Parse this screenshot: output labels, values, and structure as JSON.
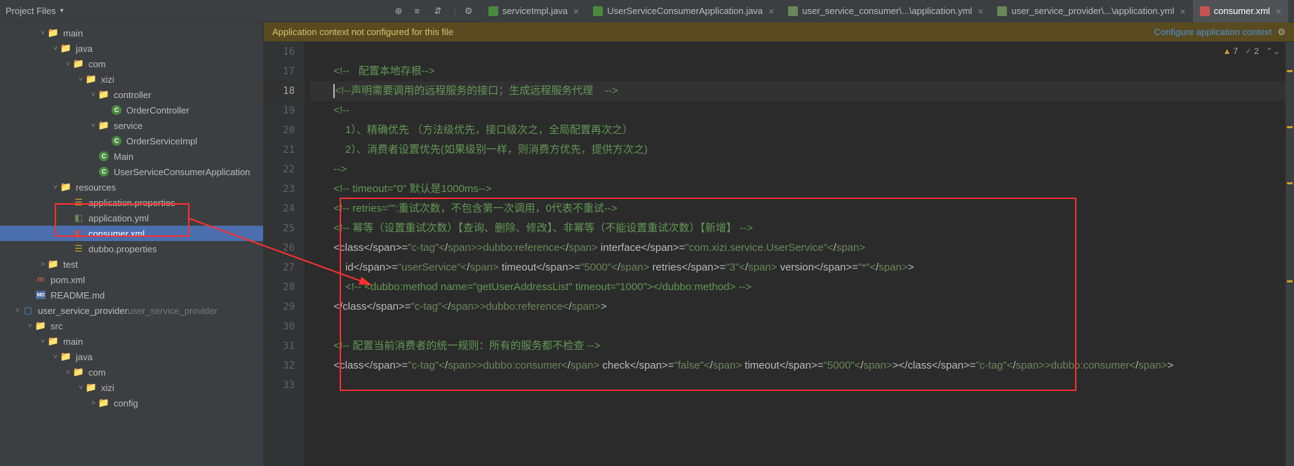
{
  "toolbar": {
    "project_label": "Project Files"
  },
  "tabs": [
    {
      "label": "serviceImpl.java",
      "icon": "java"
    },
    {
      "label": "UserServiceConsumerApplication.java",
      "icon": "java"
    },
    {
      "label": "user_service_consumer\\...\\application.yml",
      "icon": "yml"
    },
    {
      "label": "user_service_provider\\...\\application.yml",
      "icon": "yml"
    },
    {
      "label": "consumer.xml",
      "icon": "xml",
      "active": true
    }
  ],
  "banner": {
    "msg": "Application context not configured for this file",
    "link": "Configure application context"
  },
  "inspection": {
    "warn": "7",
    "typo": "2"
  },
  "tree": [
    {
      "d": 2,
      "exp": true,
      "icon": "folder-blue",
      "label": "main"
    },
    {
      "d": 3,
      "exp": true,
      "icon": "folder-blue",
      "label": "java"
    },
    {
      "d": 4,
      "exp": true,
      "icon": "folder",
      "label": "com"
    },
    {
      "d": 5,
      "exp": true,
      "icon": "folder",
      "label": "xizi"
    },
    {
      "d": 6,
      "exp": true,
      "icon": "folder",
      "label": "controller"
    },
    {
      "d": 7,
      "icon": "class",
      "label": "OrderController"
    },
    {
      "d": 6,
      "exp": true,
      "icon": "folder",
      "label": "service"
    },
    {
      "d": 7,
      "icon": "class",
      "label": "OrderServiceImpl"
    },
    {
      "d": 6,
      "icon": "class",
      "label": "Main"
    },
    {
      "d": 6,
      "icon": "class-spring",
      "label": "UserServiceConsumerApplication"
    },
    {
      "d": 3,
      "exp": true,
      "icon": "folder-yellow",
      "label": "resources"
    },
    {
      "d": 4,
      "icon": "prop",
      "label": "application.properties"
    },
    {
      "d": 4,
      "icon": "yml",
      "label": "application.yml"
    },
    {
      "d": 4,
      "icon": "xml",
      "label": "consumer.xml",
      "selected": true
    },
    {
      "d": 4,
      "icon": "prop",
      "label": "dubbo.properties"
    },
    {
      "d": 2,
      "exp": false,
      "icon": "folder-blue",
      "label": "test"
    },
    {
      "d": 1,
      "icon": "maven",
      "label": "pom.xml"
    },
    {
      "d": 1,
      "icon": "md",
      "label": "README.md"
    },
    {
      "d": 0,
      "exp": true,
      "icon": "module",
      "label": "user_service_provider",
      "hint": "user_service_provider"
    },
    {
      "d": 1,
      "exp": true,
      "icon": "folder-blue",
      "label": "src"
    },
    {
      "d": 2,
      "exp": true,
      "icon": "folder-blue",
      "label": "main"
    },
    {
      "d": 3,
      "exp": true,
      "icon": "folder-blue",
      "label": "java"
    },
    {
      "d": 4,
      "exp": true,
      "icon": "folder",
      "label": "com"
    },
    {
      "d": 5,
      "exp": true,
      "icon": "folder",
      "label": "xizi"
    },
    {
      "d": 6,
      "exp": false,
      "icon": "folder",
      "label": "config"
    }
  ],
  "code": {
    "start": 16,
    "lines": [
      "",
      "        <!--   配置本地存根-->",
      "        |<!--声明需要调用的远程服务的接口；生成远程服务代理    -->",
      "        <!--",
      "            1）、精确优先 （方法级优先，接口级次之，全局配置再次之）",
      "            2）、消费者设置优先(如果级别一样，则消费方优先，提供方次之)",
      "        -->",
      "        <!-- timeout=\"0\" 默认是1000ms-->",
      "        <!-- retries=\"\":重试次数，不包含第一次调用，0代表不重试-->",
      "        <!-- 幂等（设置重试次数）【查询、删除、修改】、非幂等（不能设置重试次数）【新增】 -->",
      "        <dubbo:reference interface=\"com.xizi.service.UserService\"",
      "            id=\"userService\" timeout=\"5000\" retries=\"3\" version=\"*\">",
      "            <!-- <dubbo:method name=\"getUserAddressList\" timeout=\"1000\"></dubbo:method> -->",
      "        </dubbo:reference>",
      "",
      "        <!-- 配置当前消费者的统一规则：所有的服务都不检查 -->",
      "        <dubbo:consumer check=\"false\" timeout=\"5000\"></dubbo:consumer>",
      ""
    ],
    "hl_line": 18
  }
}
